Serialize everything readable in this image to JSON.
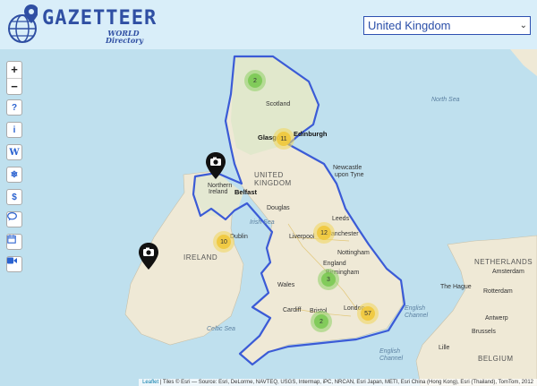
{
  "header": {
    "title": "GAZETTEER",
    "subtitle_line1": "WORLD",
    "subtitle_line2": "Directory",
    "logo_icon": "globe-pin-icon"
  },
  "country_select": {
    "value": "United Kingdom",
    "icon": "chevron-down-icon"
  },
  "map_controls": {
    "zoom_in": "+",
    "zoom_out": "−",
    "tools": [
      {
        "name": "help",
        "glyph": "?"
      },
      {
        "name": "info",
        "glyph": "i"
      },
      {
        "name": "wikipedia",
        "glyph": "W"
      },
      {
        "name": "weather",
        "glyph": "❄"
      },
      {
        "name": "currency",
        "glyph": "$"
      },
      {
        "name": "news",
        "glyph": "💬"
      },
      {
        "name": "calendar",
        "glyph": "📅"
      },
      {
        "name": "webcam",
        "glyph": "■"
      }
    ]
  },
  "map": {
    "seas": {
      "north_sea": "North Sea",
      "irish_sea": "Irish Sea",
      "celtic_sea": "Celtic Sea",
      "english_channel_1": "English",
      "english_channel_2": "Channel",
      "english_channel_3": "English",
      "english_channel_4": "Channel"
    },
    "countries": {
      "uk_1": "UNITED",
      "uk_2": "KINGDOM",
      "ireland": "IRELAND",
      "netherlands": "NETHERLANDS",
      "belgium": "BELGIUM"
    },
    "regions": {
      "scotland": "Scotland",
      "northern_ireland_1": "Northern",
      "northern_ireland_2": "Ireland",
      "england": "England",
      "wales": "Wales"
    },
    "cities": {
      "glasgow": "Glasgow",
      "edinburgh": "Edinburgh",
      "belfast": "Belfast",
      "douglas": "Douglas",
      "newcastle_1": "Newcastle",
      "newcastle_2": "upon Tyne",
      "leeds": "Leeds",
      "manchester": "Manchester",
      "liverpool": "Liverpool",
      "nottingham": "Nottingham",
      "birmingham": "Birmingham",
      "dublin": "Dublin",
      "cardiff": "Cardiff",
      "bristol": "Bristol",
      "london": "London",
      "the_hague": "The Hague",
      "rotterdam": "Rotterdam",
      "antwerp": "Antwerp",
      "brussels": "Brussels",
      "lille": "Lille",
      "amsterdam": "Amsterdam"
    },
    "clusters": [
      {
        "label": "2",
        "color": "green"
      },
      {
        "label": "11",
        "color": "yellow"
      },
      {
        "label": "12",
        "color": "yellow"
      },
      {
        "label": "10",
        "color": "yellow"
      },
      {
        "label": "3",
        "color": "green"
      },
      {
        "label": "57",
        "color": "yellow"
      },
      {
        "label": "2",
        "color": "green"
      }
    ],
    "markers": [
      "camera-marker-icon",
      "camera-marker-icon"
    ]
  },
  "attribution": {
    "leaflet": "Leaflet",
    "text": " | Tiles © Esri — Source: Esri, DeLorme, NAVTEQ, USGS, Intermap, iPC, NRCAN, Esri Japan, METI, Esri China (Hong Kong), Esri (Thailand), TomTom, 2012"
  },
  "colors": {
    "header_bg": "#d9eef9",
    "brand": "#2f4fa3",
    "border_line": "#3b5bd6",
    "sea": "#bfe0ee",
    "land": "#efe9d6"
  }
}
